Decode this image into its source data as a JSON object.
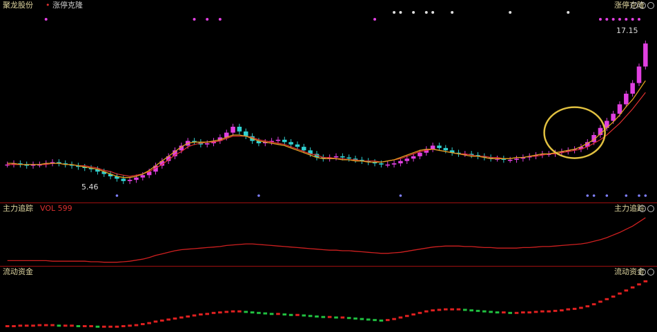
{
  "header": {
    "stock_name": "聚龙股份",
    "indicator_name": "涨停克隆",
    "right_label": "涨停克隆",
    "price_high_label": "17.15",
    "price_low_label": "5.46"
  },
  "ind1": {
    "title": "主力追踪",
    "value_label": "VOL 599",
    "right_label": "主力追踪"
  },
  "ind2": {
    "title": "流动资金",
    "right_label": "流动资金"
  },
  "colors": {
    "up": "#e040e0",
    "down": "#30d0d0",
    "ma_fast": "#e0a020",
    "ma_slow": "#e03030",
    "accent": "#a01010"
  },
  "chart_data": [
    {
      "type": "candlestick",
      "title": "聚龙股份",
      "ylim": [
        4.5,
        18.5
      ],
      "x_count": 100,
      "closes": [
        6.9,
        7.0,
        6.9,
        6.8,
        6.9,
        6.9,
        7.0,
        7.1,
        7.0,
        6.9,
        6.8,
        6.7,
        6.6,
        6.5,
        6.3,
        6.1,
        5.9,
        5.7,
        5.5,
        5.6,
        5.8,
        6.0,
        6.3,
        6.8,
        7.2,
        7.6,
        8.1,
        8.5,
        8.9,
        8.8,
        8.6,
        8.7,
        8.9,
        9.2,
        9.6,
        10.1,
        9.7,
        9.3,
        8.9,
        8.7,
        8.8,
        8.9,
        9.0,
        8.8,
        8.6,
        8.4,
        8.1,
        7.8,
        7.5,
        7.4,
        7.5,
        7.6,
        7.5,
        7.4,
        7.3,
        7.2,
        7.1,
        7.0,
        6.9,
        6.9,
        7.0,
        7.2,
        7.4,
        7.6,
        7.9,
        8.2,
        8.5,
        8.3,
        8.1,
        7.9,
        7.8,
        7.8,
        7.7,
        7.6,
        7.5,
        7.4,
        7.4,
        7.3,
        7.3,
        7.4,
        7.5,
        7.6,
        7.7,
        7.8,
        7.8,
        7.9,
        8.0,
        8.1,
        8.2,
        8.4,
        8.8,
        9.4,
        10.0,
        10.6,
        11.2,
        12.0,
        12.9,
        13.8,
        15.2,
        17.15
      ],
      "ma_fast": [
        7.0,
        7.0,
        6.9,
        6.9,
        6.9,
        6.9,
        7.0,
        7.0,
        7.0,
        6.9,
        6.9,
        6.8,
        6.7,
        6.6,
        6.5,
        6.3,
        6.1,
        5.9,
        5.8,
        5.8,
        5.9,
        6.1,
        6.4,
        6.8,
        7.2,
        7.6,
        8.0,
        8.4,
        8.7,
        8.8,
        8.8,
        8.8,
        8.9,
        9.0,
        9.2,
        9.4,
        9.4,
        9.3,
        9.1,
        8.9,
        8.8,
        8.7,
        8.6,
        8.5,
        8.3,
        8.1,
        7.9,
        7.7,
        7.5,
        7.4,
        7.4,
        7.4,
        7.3,
        7.3,
        7.2,
        7.2,
        7.1,
        7.1,
        7.1,
        7.2,
        7.3,
        7.5,
        7.7,
        7.9,
        8.1,
        8.2,
        8.2,
        8.1,
        8.0,
        7.9,
        7.8,
        7.7,
        7.6,
        7.6,
        7.5,
        7.4,
        7.4,
        7.4,
        7.4,
        7.5,
        7.5,
        7.6,
        7.7,
        7.8,
        7.8,
        7.9,
        8.0,
        8.1,
        8.2,
        8.4,
        8.7,
        9.0,
        9.5,
        10.0,
        10.5,
        11.1,
        11.8,
        12.4,
        13.2,
        14.0
      ],
      "ma_slow": [
        6.9,
        6.9,
        6.9,
        6.9,
        6.9,
        6.9,
        6.9,
        7.0,
        7.0,
        6.9,
        6.9,
        6.8,
        6.8,
        6.7,
        6.6,
        6.4,
        6.3,
        6.1,
        6.0,
        5.9,
        6.0,
        6.1,
        6.3,
        6.6,
        6.9,
        7.3,
        7.7,
        8.0,
        8.4,
        8.6,
        8.7,
        8.8,
        8.8,
        8.9,
        9.1,
        9.3,
        9.3,
        9.3,
        9.2,
        9.0,
        8.9,
        8.8,
        8.7,
        8.6,
        8.4,
        8.2,
        8.0,
        7.8,
        7.7,
        7.5,
        7.5,
        7.4,
        7.4,
        7.3,
        7.3,
        7.2,
        7.2,
        7.2,
        7.1,
        7.2,
        7.3,
        7.4,
        7.6,
        7.8,
        8.0,
        8.1,
        8.2,
        8.1,
        8.0,
        7.9,
        7.8,
        7.8,
        7.7,
        7.6,
        7.6,
        7.5,
        7.5,
        7.4,
        7.4,
        7.5,
        7.5,
        7.6,
        7.6,
        7.7,
        7.8,
        7.8,
        7.9,
        8.0,
        8.1,
        8.2,
        8.4,
        8.7,
        9.0,
        9.4,
        9.9,
        10.4,
        11.0,
        11.6,
        12.3,
        13.0
      ]
    },
    {
      "type": "line",
      "title": "主力追踪",
      "ylim": [
        0,
        100
      ],
      "values": [
        6,
        6,
        6,
        6,
        6,
        6,
        6,
        5,
        5,
        5,
        5,
        5,
        5,
        4,
        4,
        3,
        3,
        3,
        4,
        5,
        7,
        9,
        12,
        16,
        19,
        22,
        25,
        27,
        28,
        29,
        30,
        31,
        32,
        33,
        35,
        36,
        37,
        38,
        38,
        37,
        36,
        35,
        34,
        33,
        32,
        31,
        30,
        29,
        28,
        27,
        26,
        26,
        25,
        25,
        24,
        23,
        22,
        21,
        20,
        20,
        21,
        22,
        24,
        26,
        28,
        30,
        32,
        33,
        34,
        34,
        34,
        33,
        33,
        32,
        31,
        31,
        30,
        30,
        30,
        30,
        31,
        31,
        32,
        33,
        33,
        34,
        35,
        36,
        37,
        38,
        40,
        43,
        46,
        50,
        55,
        60,
        66,
        72,
        80,
        88
      ]
    },
    {
      "type": "bar",
      "title": "流动资金",
      "ylim": [
        0,
        100
      ],
      "values": [
        4,
        4,
        5,
        5,
        5,
        6,
        6,
        6,
        5,
        5,
        5,
        4,
        4,
        4,
        3,
        3,
        3,
        3,
        4,
        5,
        6,
        8,
        10,
        13,
        15,
        17,
        19,
        21,
        23,
        25,
        27,
        28,
        30,
        31,
        32,
        33,
        33,
        32,
        31,
        30,
        29,
        28,
        28,
        27,
        26,
        26,
        25,
        24,
        23,
        22,
        22,
        21,
        21,
        20,
        19,
        18,
        17,
        16,
        15,
        16,
        18,
        21,
        24,
        27,
        30,
        33,
        35,
        36,
        37,
        37,
        37,
        36,
        35,
        34,
        33,
        32,
        31,
        31,
        30,
        30,
        31,
        31,
        32,
        33,
        33,
        34,
        35,
        37,
        38,
        40,
        43,
        47,
        52,
        57,
        62,
        68,
        74,
        80,
        86,
        92
      ]
    }
  ]
}
